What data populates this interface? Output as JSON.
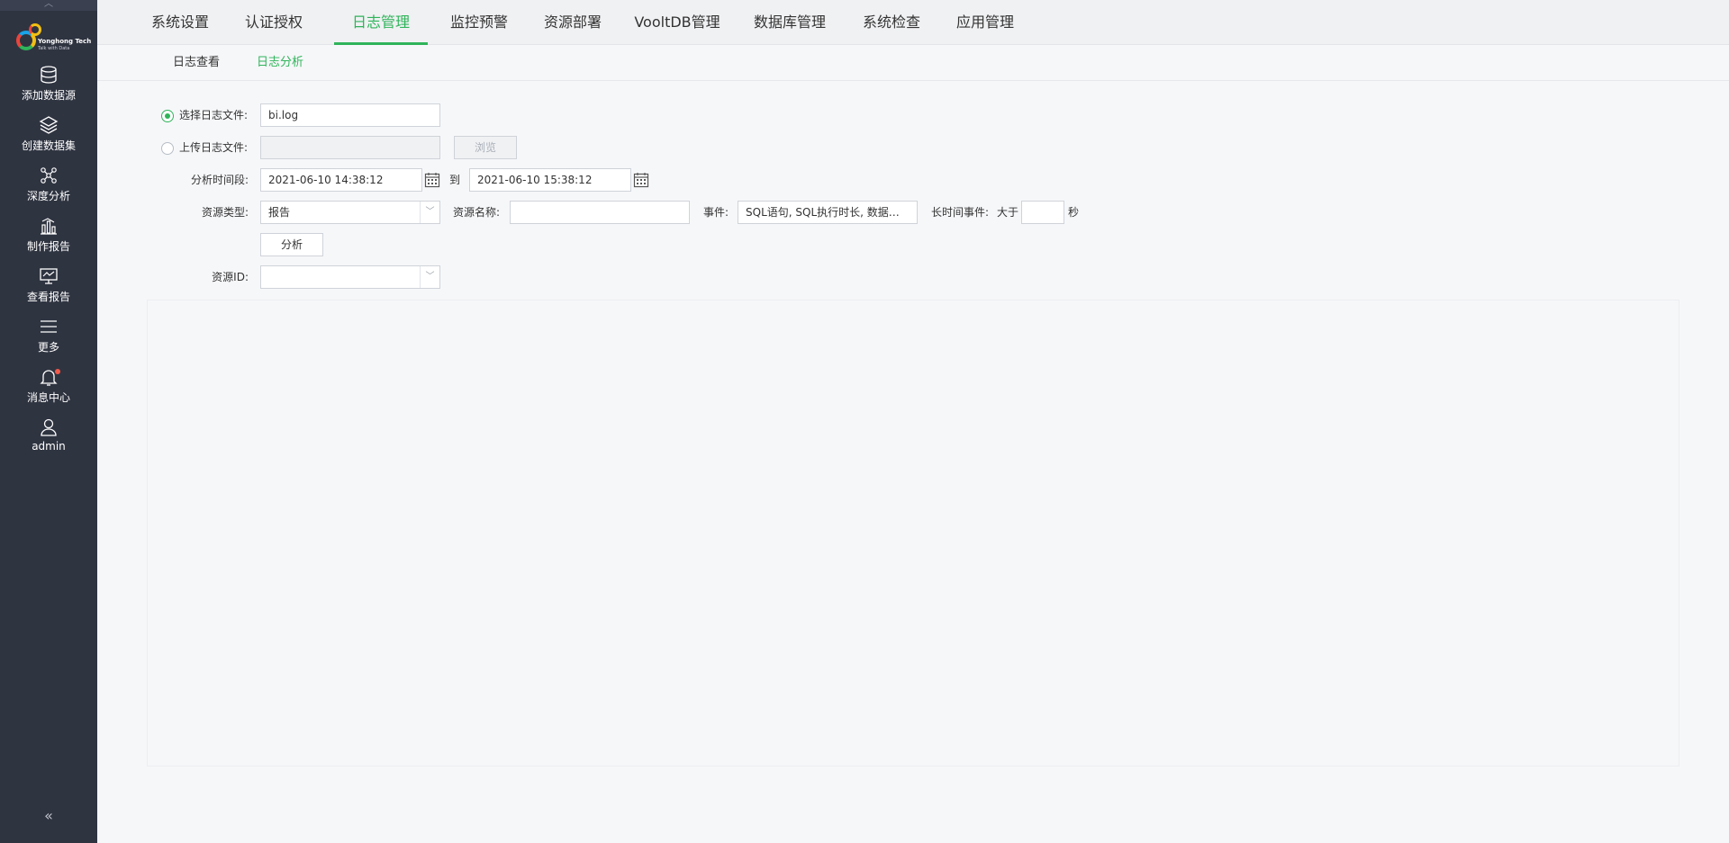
{
  "sidebar": {
    "logo": {
      "brand": "Yonghong Tech",
      "tagline": "Talk with Data"
    },
    "items": [
      {
        "label": "添加数据源",
        "icon": "database-icon"
      },
      {
        "label": "创建数据集",
        "icon": "layers-icon"
      },
      {
        "label": "深度分析",
        "icon": "network-icon"
      },
      {
        "label": "制作报告",
        "icon": "bar-chart-icon"
      },
      {
        "label": "查看报告",
        "icon": "monitor-chart-icon"
      },
      {
        "label": "更多",
        "icon": "menu-icon"
      },
      {
        "label": "消息中心",
        "icon": "bell-icon"
      },
      {
        "label": "admin",
        "icon": "user-icon"
      }
    ],
    "collapse": "«"
  },
  "top_tabs": [
    {
      "label": "系统设置"
    },
    {
      "label": "认证授权"
    },
    {
      "label": "日志管理",
      "active": true
    },
    {
      "label": "监控预警"
    },
    {
      "label": "资源部署"
    },
    {
      "label": "VooltDB管理"
    },
    {
      "label": "数据库管理"
    },
    {
      "label": "系统检查"
    },
    {
      "label": "应用管理"
    }
  ],
  "sub_tabs": [
    {
      "label": "日志查看"
    },
    {
      "label": "日志分析",
      "active": true
    }
  ],
  "form": {
    "select_log_label": "选择日志文件:",
    "select_log_value": "bi.log",
    "upload_log_label": "上传日志文件:",
    "browse_label": "浏览",
    "time_range_label": "分析时间段:",
    "start_time": "2021-06-10 14:38:12",
    "to_label": "到",
    "end_time": "2021-06-10 15:38:12",
    "resource_type_label": "资源类型:",
    "resource_type_value": "报告",
    "resource_name_label": "资源名称:",
    "resource_name_value": "",
    "event_label": "事件:",
    "event_value": "SQL语句, SQL执行时长, 数据库数...",
    "long_event_label": "长时间事件:",
    "greater_than_label": "大于",
    "seconds_value": "",
    "seconds_unit": "秒",
    "analyze_button": "分析",
    "resource_id_label": "资源ID:",
    "resource_id_value": ""
  },
  "colors": {
    "accent": "#2fb45a",
    "sidebar": "#2f3441"
  }
}
